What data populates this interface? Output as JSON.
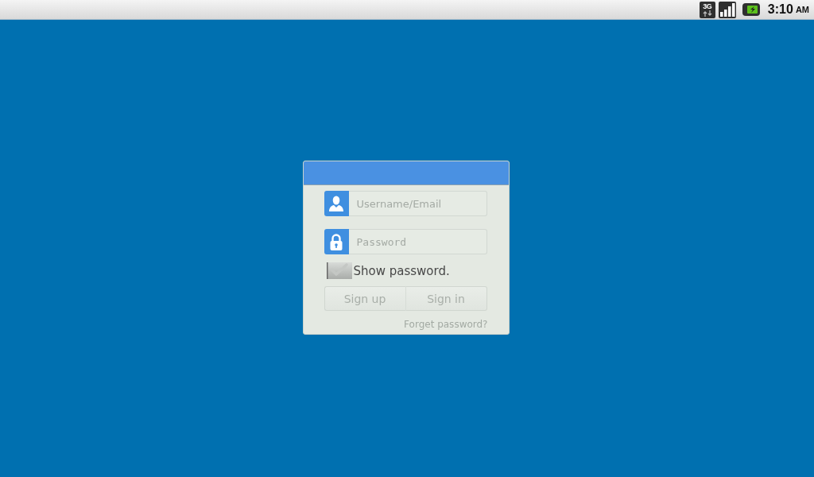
{
  "status_bar": {
    "network_type": "3G",
    "time": "3:10",
    "time_suffix": "AM"
  },
  "login": {
    "username": {
      "placeholder": "Username/Email"
    },
    "password": {
      "placeholder": "Password"
    },
    "show_password": {
      "label": "Show password.",
      "checked": false
    },
    "buttons": [
      {
        "label": "Sign up"
      },
      {
        "label": "Sign in"
      }
    ],
    "forgot_link": "Forget password?"
  }
}
